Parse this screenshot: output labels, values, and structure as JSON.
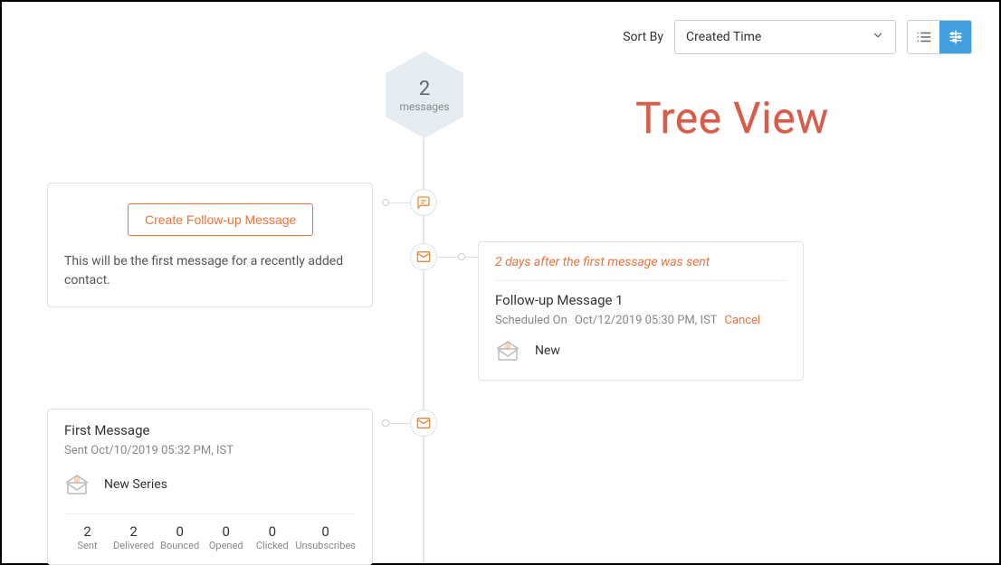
{
  "topbar": {
    "sort_label": "Sort By",
    "sort_value": "Created Time"
  },
  "annotation": "Tree View",
  "hex": {
    "count": "2",
    "label": "messages"
  },
  "create_card": {
    "button_label": "Create Follow-up Message",
    "description": "This will be the first message for a recently added contact."
  },
  "followup_card": {
    "rule_text": "2  days after the first message was sent",
    "title": "Follow-up Message 1",
    "scheduled_label": "Scheduled On",
    "scheduled_value": "Oct/12/2019 05:30 PM, IST",
    "cancel_label": "Cancel",
    "status": "New"
  },
  "first_card": {
    "title": "First Message",
    "sent_label": "Sent",
    "sent_value": "Oct/10/2019 05:32 PM, IST",
    "series_name": "New Series",
    "stats": [
      {
        "value": "2",
        "label": "Sent"
      },
      {
        "value": "2",
        "label": "Delivered"
      },
      {
        "value": "0",
        "label": "Bounced"
      },
      {
        "value": "0",
        "label": "Opened"
      },
      {
        "value": "0",
        "label": "Clicked"
      },
      {
        "value": "0",
        "label": "Unsubscribes"
      }
    ]
  }
}
